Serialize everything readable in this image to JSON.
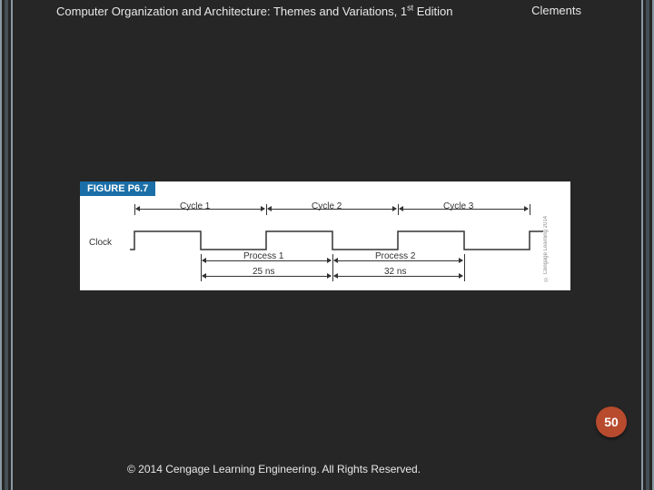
{
  "header": {
    "title_pre": "Computer Organization and Architecture: Themes and Variations, 1",
    "title_sup": "st",
    "title_post": " Edition",
    "author": "Clements"
  },
  "figure": {
    "label": "FIGURE P6.7",
    "cycles": [
      "Cycle 1",
      "Cycle 2",
      "Cycle 3"
    ],
    "clock_label": "Clock",
    "processes": [
      "Process 1",
      "Process 2"
    ],
    "durations": [
      "25 ns",
      "32 ns"
    ],
    "side_copy": "© Cengage Learning 2014"
  },
  "page_number": "50",
  "footer": "© 2014 Cengage Learning Engineering. All Rights Reserved."
}
